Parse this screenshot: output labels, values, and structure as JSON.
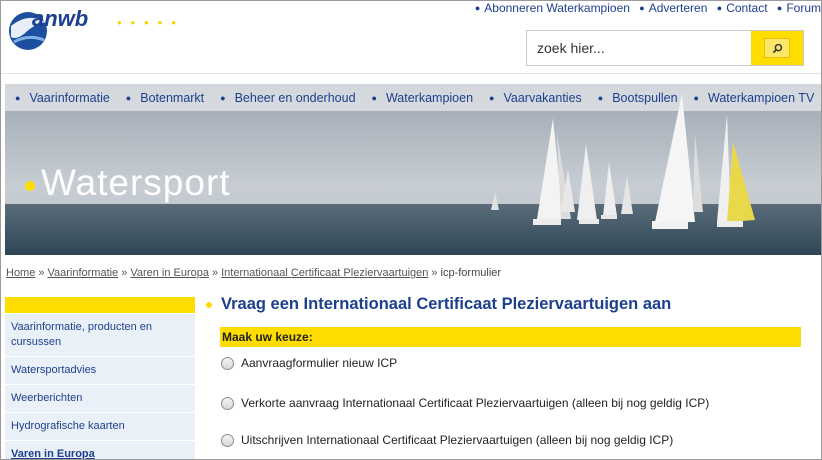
{
  "header": {
    "logo_text": "anwb",
    "top_links": [
      "Abonneren Waterkampioen",
      "Adverteren",
      "Contact",
      "Forum"
    ],
    "search_placeholder": "zoek hier..."
  },
  "nav": {
    "items": [
      "Vaarinformatie",
      "Botenmarkt",
      "Beheer en onderhoud",
      "Waterkampioen",
      "Vaarvakanties",
      "Bootspullen",
      "Waterkampioen TV"
    ]
  },
  "banner": {
    "title": "Watersport"
  },
  "breadcrumb": {
    "links": [
      "Home",
      "Vaarinformatie",
      "Varen in Europa",
      "Internationaal Certificaat Pleziervaartuigen"
    ],
    "current": "icp-formulier",
    "separator": "»"
  },
  "sidebar": {
    "items": [
      "Vaarinformatie, producten en cursussen",
      "Watersportadvies",
      "Weerberichten",
      "Hydrografische kaarten",
      "Varen in Europa"
    ],
    "active_index": 4
  },
  "main": {
    "heading": "Vraag een Internationaal Certificaat Pleziervaartuigen aan",
    "choice_label": "Maak uw keuze:",
    "options": [
      "Aanvraagformulier nieuw ICP",
      "Verkorte aanvraag Internationaal Certificaat Pleziervaartuigen (alleen bij nog geldig ICP)",
      "Uitschrijven Internationaal Certificaat Pleziervaartuigen (alleen bij nog geldig ICP)"
    ]
  },
  "colors": {
    "brand_blue": "#1d3f8f",
    "brand_yellow": "#ffdd00"
  }
}
